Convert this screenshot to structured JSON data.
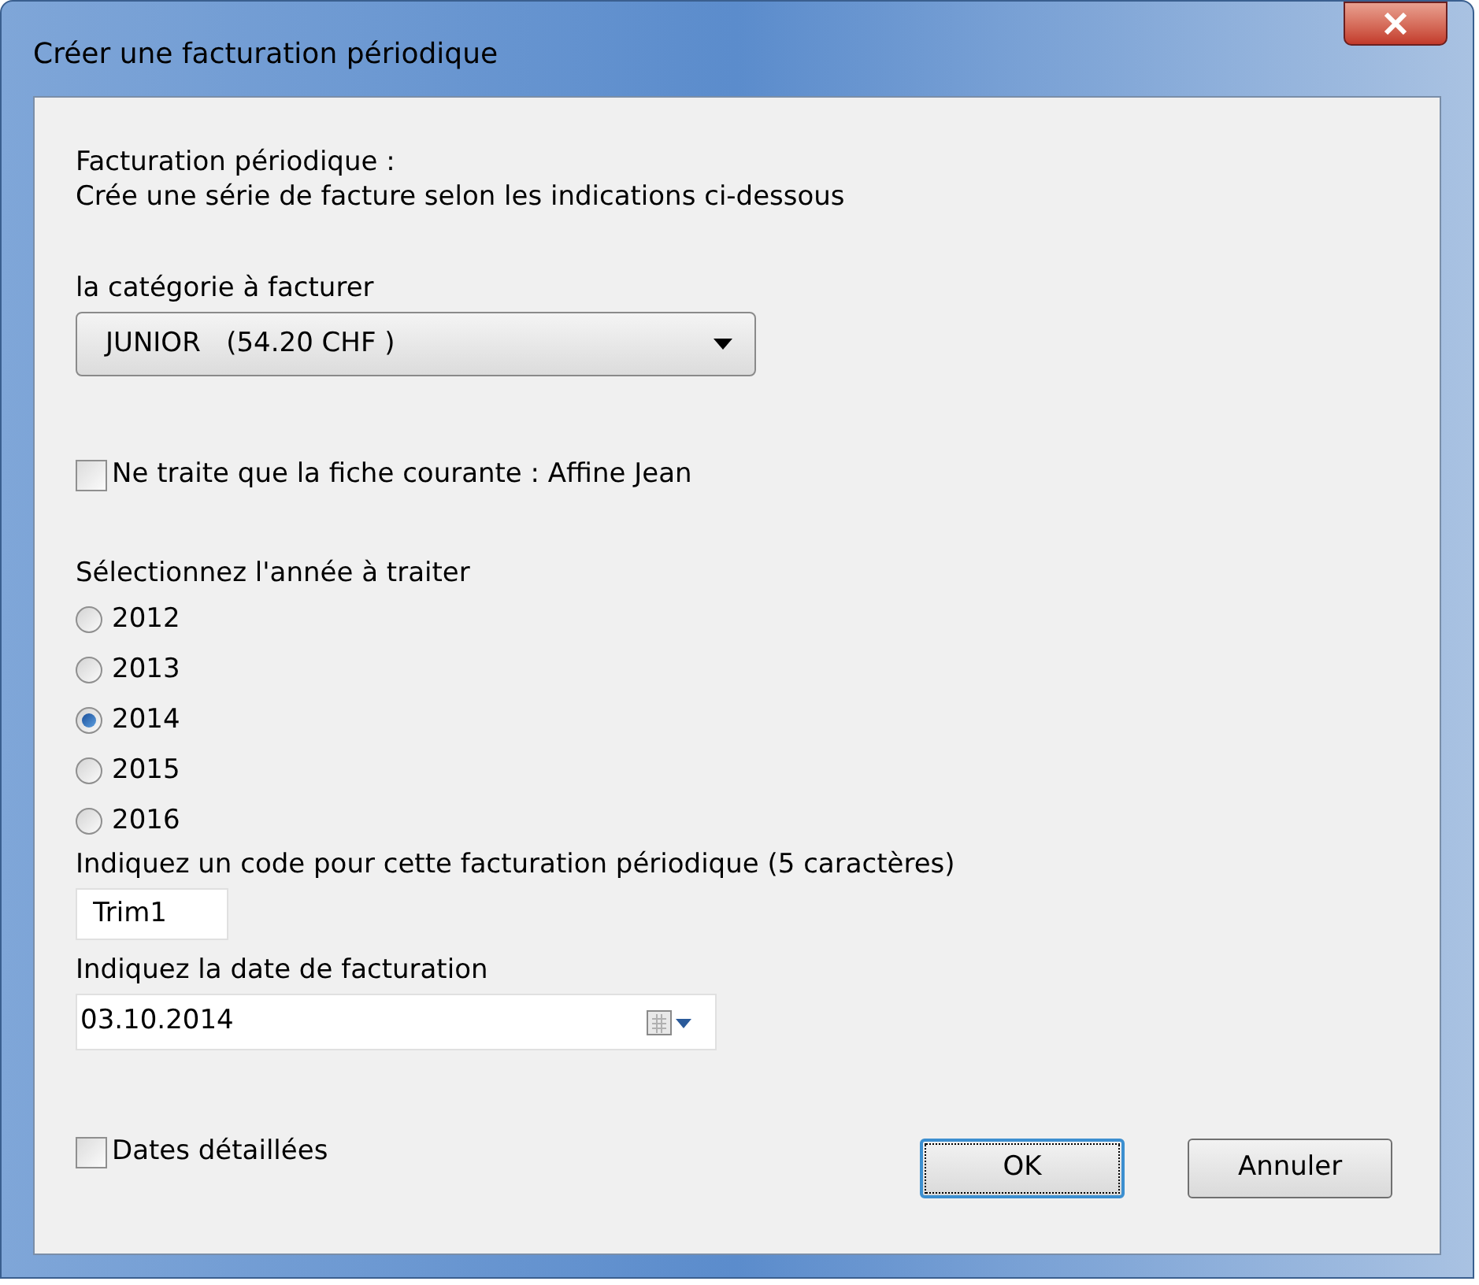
{
  "window": {
    "title": "Créer une facturation périodique"
  },
  "intro": {
    "heading": "Facturation périodique :",
    "description": "Crée une série de facture selon les indications ci-dessous"
  },
  "category": {
    "label": "la catégorie à facturer",
    "value": "JUNIOR   (54.20 CHF )"
  },
  "current_record": {
    "label": "Ne traite que la fiche courante : Affine Jean",
    "checked": false
  },
  "year": {
    "label": "Sélectionnez l'année à traiter",
    "options": [
      {
        "label": "2012",
        "selected": false
      },
      {
        "label": "2013",
        "selected": false
      },
      {
        "label": "2014",
        "selected": true
      },
      {
        "label": "2015",
        "selected": false
      },
      {
        "label": "2016",
        "selected": false
      }
    ]
  },
  "code": {
    "label": "Indiquez un code pour cette facturation périodique (5 caractères)",
    "value": "Trim1"
  },
  "date": {
    "label": "Indiquez la date de facturation",
    "value": "03.10.2014"
  },
  "detailed_dates": {
    "label": "Dates détaillées",
    "checked": false
  },
  "buttons": [
    {
      "label": "OK",
      "default": true
    },
    {
      "label": "Annuler",
      "default": false
    }
  ]
}
